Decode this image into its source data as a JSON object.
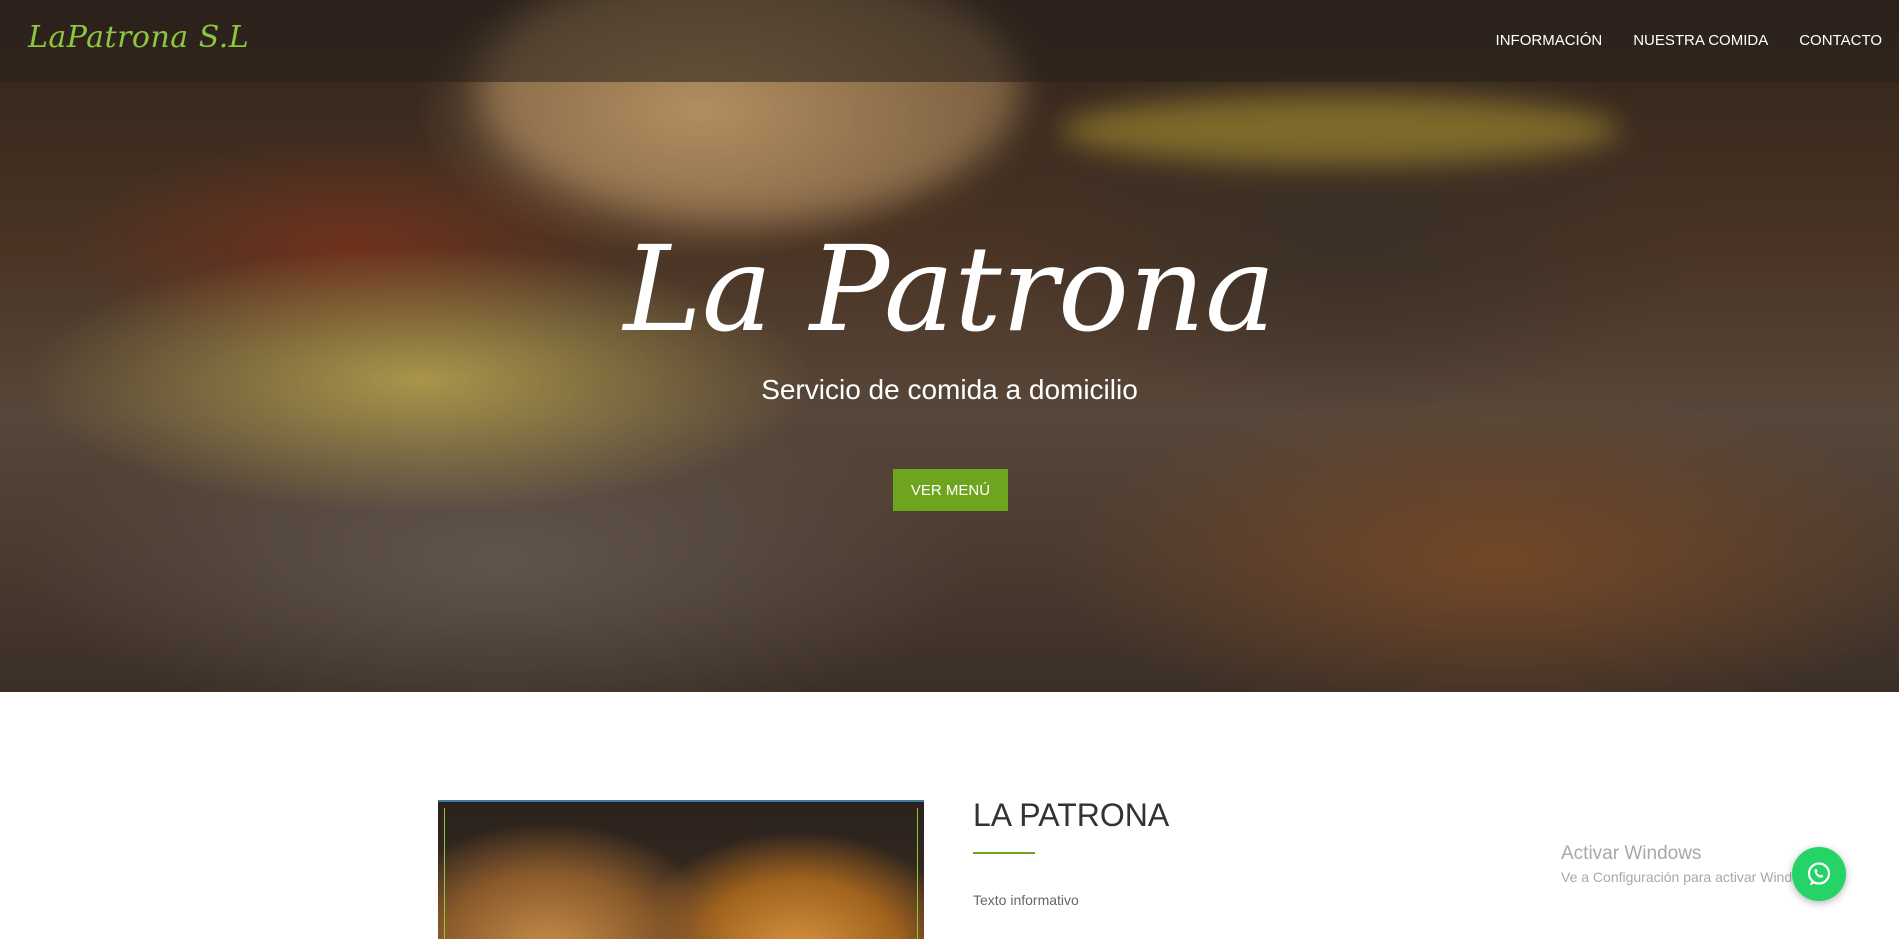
{
  "navbar": {
    "brand": "LaPatrona S.L",
    "links": [
      "INFORMACIÓN",
      "NUESTRA COMIDA",
      "CONTACTO"
    ]
  },
  "hero": {
    "title": "La Patrona",
    "subtitle": "Servicio de comida a domicilio",
    "button_label": "VER MENÚ"
  },
  "about": {
    "title": "LA PATRONA",
    "text": "Texto informativo"
  },
  "windows_watermark": {
    "title": "Activar Windows",
    "subtitle": "Ve a Configuración para activar Windows."
  },
  "icons": {
    "whatsapp": "whatsapp-icon"
  },
  "colors": {
    "accent": "#6fa41e",
    "brand": "#8dc63f",
    "whatsapp": "#25d366"
  }
}
